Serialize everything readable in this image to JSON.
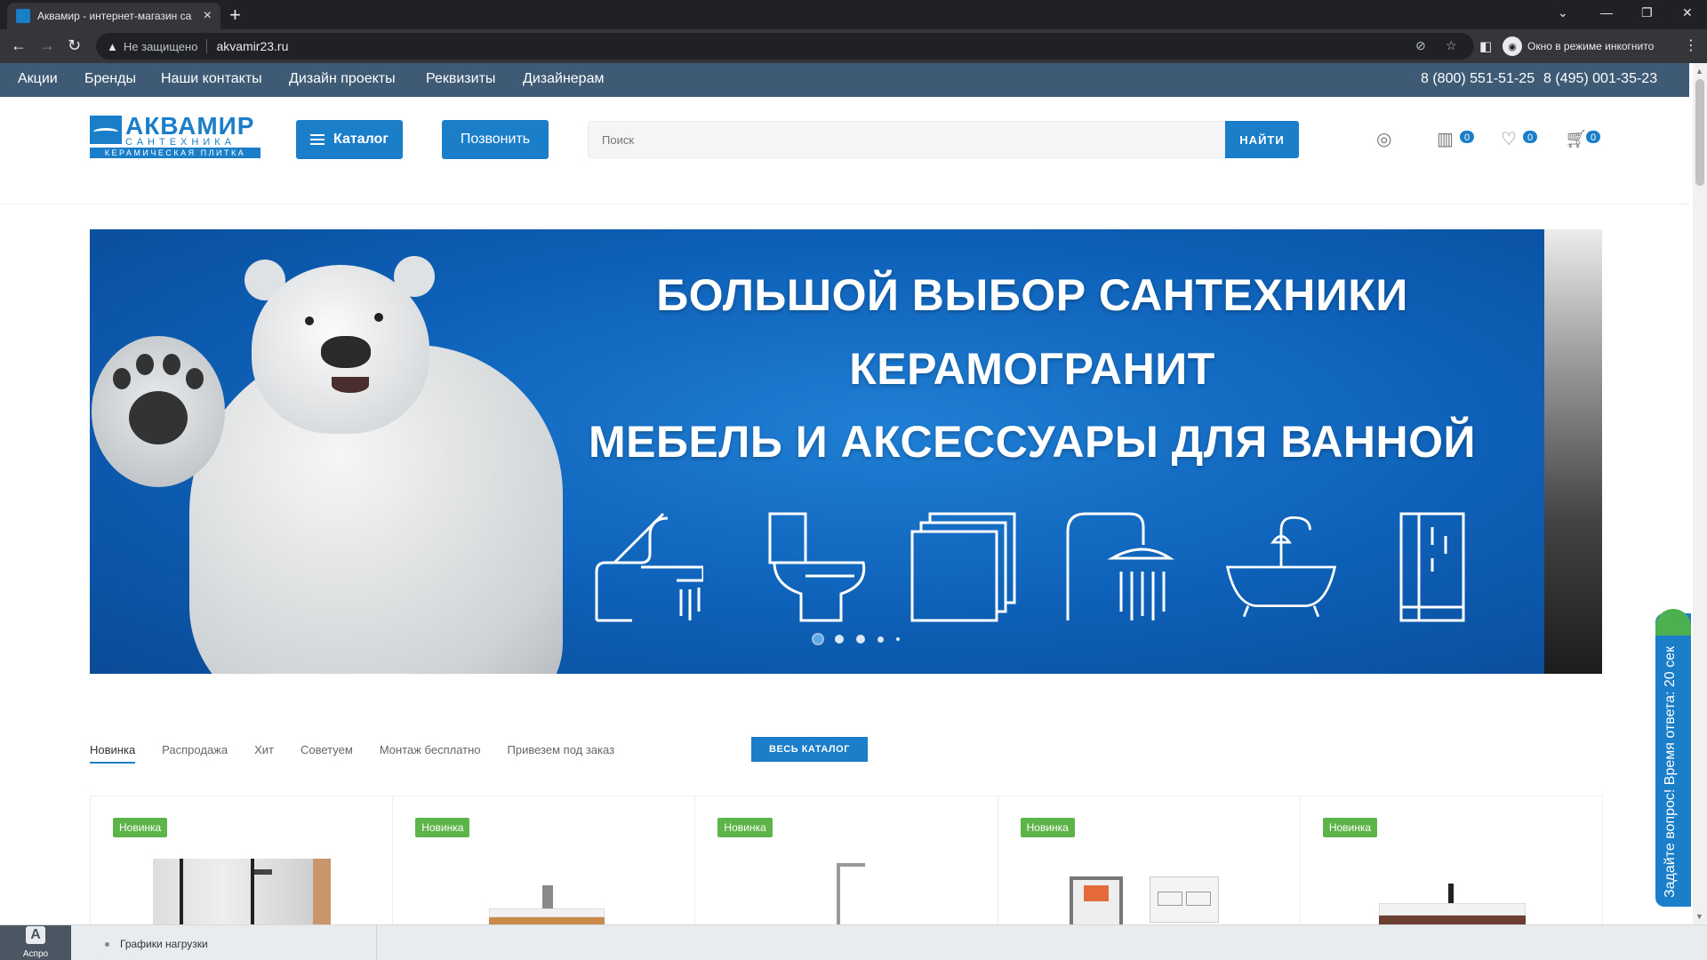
{
  "browser": {
    "tab_title": "Аквамир - интернет-магазин са",
    "new_tab": "+",
    "address_insecure": "Не защищено",
    "address_url": "akvamir23.ru",
    "incognito_label": "Окно в режиме инкогнито"
  },
  "topnav": {
    "links": [
      "Акции",
      "Бренды",
      "Наши контакты",
      "Дизайн проекты",
      "Реквизиты",
      "Дизайнерам"
    ],
    "phones": [
      "8 (800) 551-51-25",
      "8 (495) 001-35-23"
    ]
  },
  "logo": {
    "name": "АКВАМИР",
    "sub1": "САНТЕХНИКА",
    "sub2": "КЕРАМИЧЕСКАЯ ПЛИТКА"
  },
  "header": {
    "catalog_label": "Каталог",
    "call_label": "Позвонить",
    "search_placeholder": "Поиск",
    "search_button": "НАЙТИ",
    "compare_count": "0",
    "favorites_count": "0",
    "cart_count": "0"
  },
  "banner": {
    "line1": "БОЛЬШОЙ ВЫБОР САНТЕХНИКИ",
    "line2": "КЕРАМОГРАНИТ",
    "line3": "МЕБЕЛЬ И АКСЕССУАРЫ ДЛЯ ВАННОЙ",
    "slide_count": 5,
    "active_slide": 1
  },
  "product_tabs": {
    "items": [
      "Новинка",
      "Распродажа",
      "Хит",
      "Советуем",
      "Монтаж бесплатно",
      "Привезем под заказ"
    ],
    "active": "Новинка",
    "all_catalog": "ВЕСЬ КАТАЛОГ"
  },
  "products": [
    {
      "tag": "Новинка"
    },
    {
      "tag": "Новинка"
    },
    {
      "tag": "Новинка"
    },
    {
      "tag": "Новинка"
    },
    {
      "tag": "Новинка"
    }
  ],
  "ask_widget": {
    "text": "Задайте вопрос! Время ответа: 20 сек"
  },
  "bottom_panel": {
    "aspro_letter": "A",
    "aspro_label": "Аспро",
    "item": "Графики нагрузки"
  },
  "colors": {
    "brand_blue": "#1a7fc8",
    "topnav_bg": "#3f5a74",
    "new_tag_green": "#5db448"
  }
}
